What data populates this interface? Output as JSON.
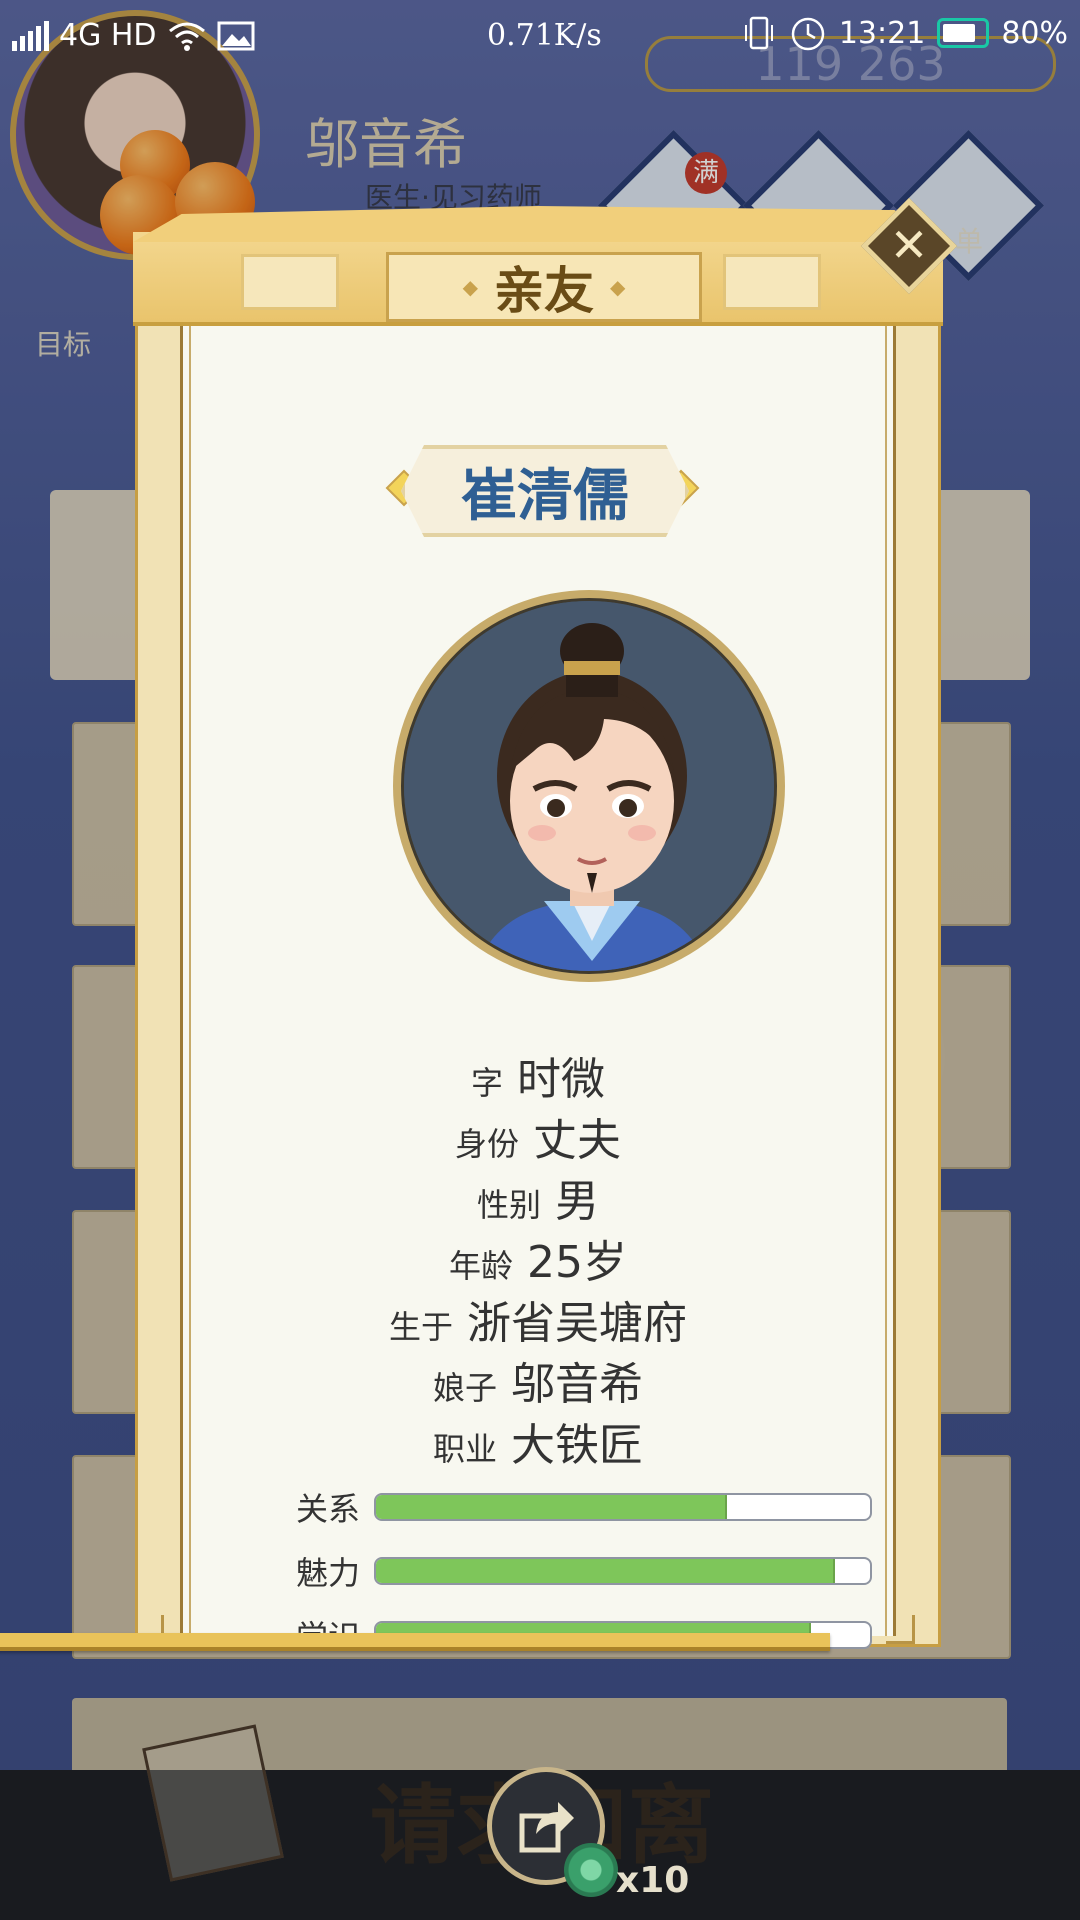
{
  "status_bar": {
    "carrier": "4G HD",
    "net_speed": "0.71K/s",
    "time": "13:21",
    "battery": "80%"
  },
  "background": {
    "player_name": "邬音希",
    "player_title": "医生·见习药师",
    "goal_label": "目标",
    "full_badge": "满",
    "right_tag": "单",
    "bottom_action": "请求和离",
    "share_count": "x10",
    "coins_display": "119 263"
  },
  "dialog": {
    "title": "亲友",
    "name": "崔清儒",
    "info": [
      {
        "k": "字",
        "v": "时微"
      },
      {
        "k": "身份",
        "v": "丈夫"
      },
      {
        "k": "性别",
        "v": "男"
      },
      {
        "k": "年龄",
        "v": "25岁"
      },
      {
        "k": "生于",
        "v": "浙省吴塘府"
      },
      {
        "k": "娘子",
        "v": "邬音希"
      },
      {
        "k": "职业",
        "v": "大铁匠"
      }
    ],
    "stats": [
      {
        "label": "关系",
        "value": 0.71
      },
      {
        "label": "魅力",
        "value": 0.93
      },
      {
        "label": "学识",
        "value": 0.88
      }
    ]
  },
  "colors": {
    "bar_fill": "#7ec65a",
    "name_text": "#2f5f93",
    "gold": "#c9a24d"
  }
}
